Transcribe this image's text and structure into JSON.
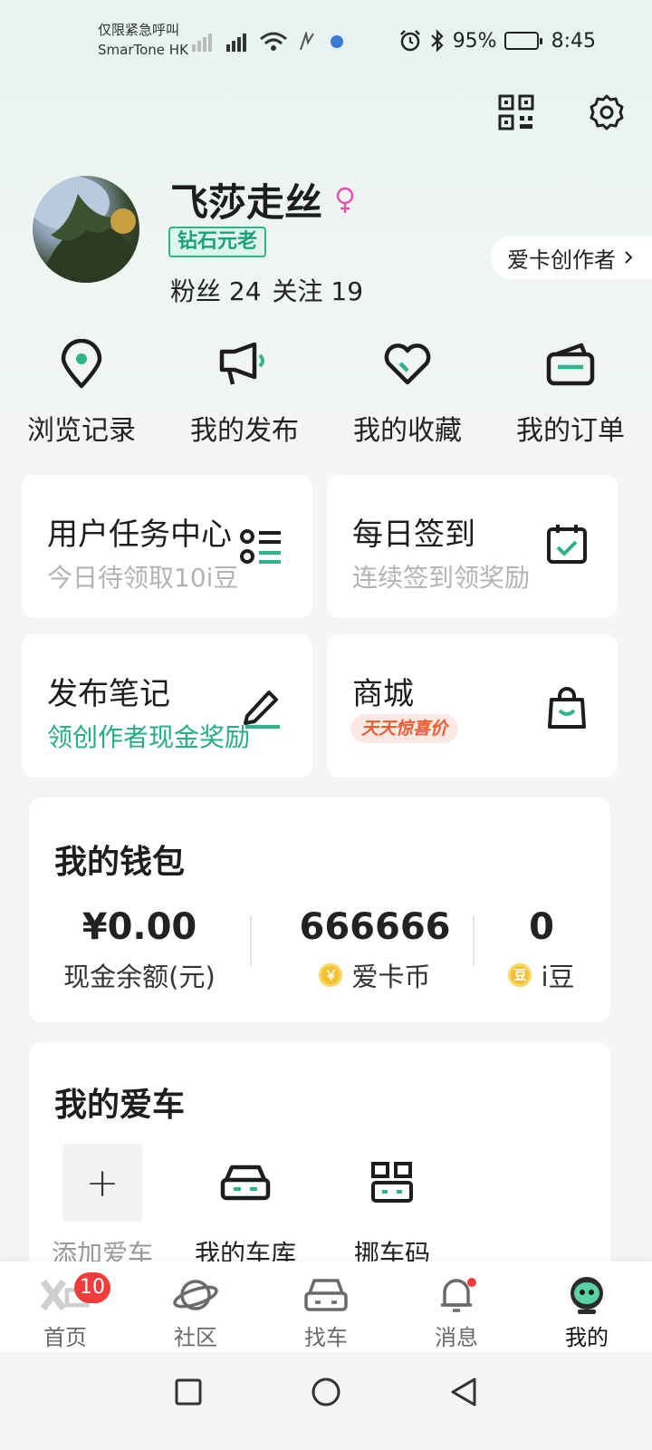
{
  "status_bar": {
    "carrier_line1": "仅限紧急呼叫",
    "carrier_line2": "SmarTone HK",
    "battery_percent": "95%",
    "time": "8:45"
  },
  "profile": {
    "username": "飞莎走丝",
    "level": "钻石元老",
    "fans": "粉丝 24",
    "following": "关注 19",
    "creator_link": "爱卡创作者"
  },
  "quick_menu": [
    {
      "label": "浏览记录",
      "icon": "location-pin-icon"
    },
    {
      "label": "我的发布",
      "icon": "megaphone-icon"
    },
    {
      "label": "我的收藏",
      "icon": "heart-icon"
    },
    {
      "label": "我的订单",
      "icon": "wallet-icon"
    }
  ],
  "tiles": {
    "task_center": {
      "title": "用户任务中心",
      "subtitle": "今日待领取10i豆"
    },
    "checkin": {
      "title": "每日签到",
      "subtitle": "连续签到领奖励"
    },
    "publish_note": {
      "title": "发布笔记",
      "subtitle": "领创作者现金奖励"
    },
    "mall": {
      "title": "商城",
      "badge": "天天惊喜价"
    }
  },
  "wallet": {
    "title": "我的钱包",
    "cash_value": "¥0.00",
    "cash_label": "现金余额(元)",
    "coin_value": "666666",
    "coin_label": "爱卡币",
    "coin_icon_text": "￥",
    "bean_value": "0",
    "bean_label": "i豆",
    "bean_icon_text": "豆"
  },
  "my_car": {
    "title": "我的爱车",
    "add_label": "添加爱车",
    "add_symbol": "+",
    "garage_label": "我的车库",
    "move_code_label": "挪车码"
  },
  "bottom_nav": {
    "home": "首页",
    "home_badge": "10",
    "community": "社区",
    "find_car": "找车",
    "messages": "消息",
    "mine": "我的"
  },
  "colors": {
    "accent_green": "#2fb38c",
    "badge_red": "#f23b3b",
    "female_pink": "#e84fb4"
  }
}
